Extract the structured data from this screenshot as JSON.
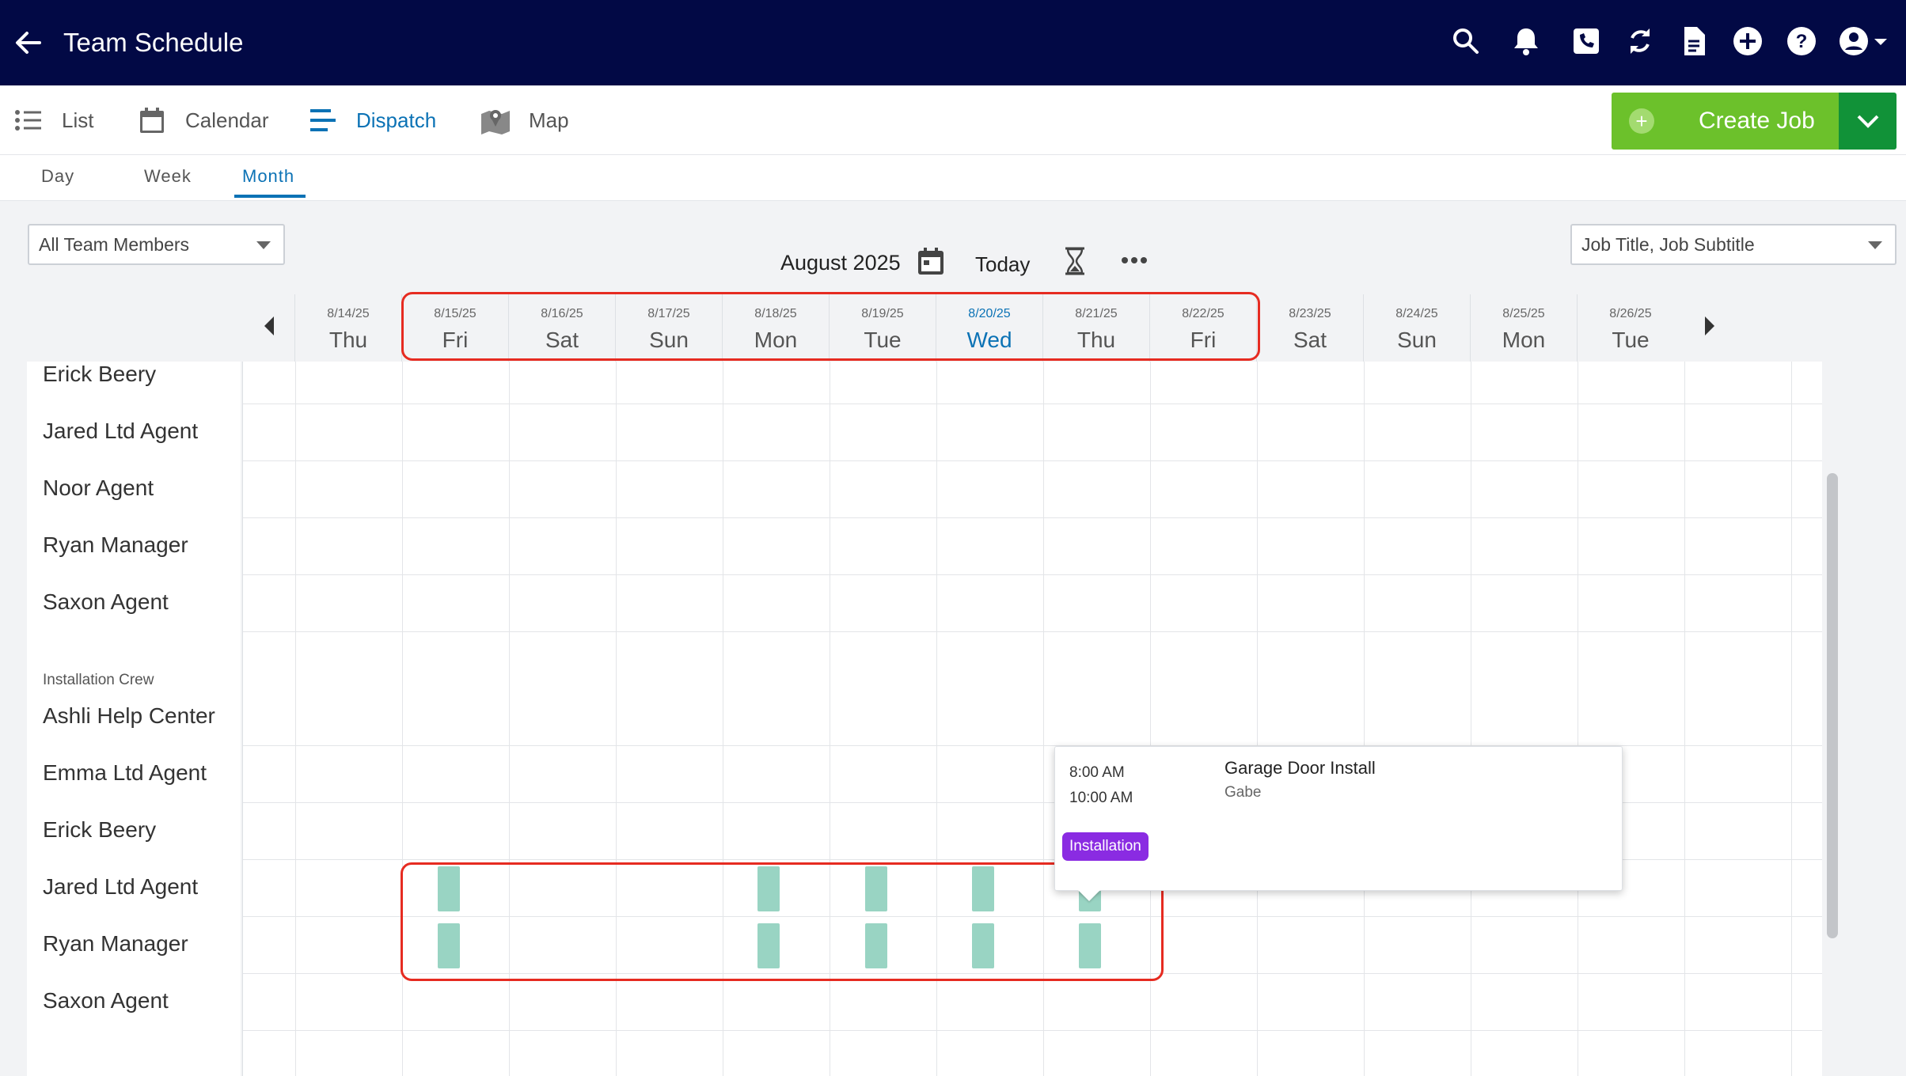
{
  "header": {
    "title": "Team Schedule",
    "icons": [
      "back-arrow-icon",
      "search-icon",
      "bell-icon",
      "phone-icon",
      "sync-icon",
      "document-icon",
      "plus-circle-icon",
      "help-icon",
      "account-icon",
      "caret-down-icon"
    ]
  },
  "views": {
    "list": "List",
    "calendar": "Calendar",
    "dispatch": "Dispatch",
    "map": "Map",
    "active": "Dispatch"
  },
  "create_job": {
    "label": "Create Job"
  },
  "periods": {
    "day": "Day",
    "week": "Week",
    "month": "Month",
    "active": "Month"
  },
  "filters": {
    "members": "All Team Members",
    "display": "Job Title, Job Subtitle"
  },
  "toolbar": {
    "month": "August 2025",
    "today": "Today"
  },
  "dates": [
    {
      "date": "8/14/25",
      "day": "Thu"
    },
    {
      "date": "8/15/25",
      "day": "Fri"
    },
    {
      "date": "8/16/25",
      "day": "Sat"
    },
    {
      "date": "8/17/25",
      "day": "Sun"
    },
    {
      "date": "8/18/25",
      "day": "Mon"
    },
    {
      "date": "8/19/25",
      "day": "Tue"
    },
    {
      "date": "8/20/25",
      "day": "Wed",
      "today": true
    },
    {
      "date": "8/21/25",
      "day": "Thu"
    },
    {
      "date": "8/22/25",
      "day": "Fri"
    },
    {
      "date": "8/23/25",
      "day": "Sat"
    },
    {
      "date": "8/24/25",
      "day": "Sun"
    },
    {
      "date": "8/25/25",
      "day": "Mon"
    },
    {
      "date": "8/26/25",
      "day": "Tue"
    }
  ],
  "members": [
    "Erick Beery",
    "Jared Ltd Agent",
    "Noor Agent",
    "Ryan Manager",
    "Saxon Agent"
  ],
  "group": {
    "label": "Installation Crew",
    "members": [
      "Ashli Help Center",
      "Emma Ltd Agent",
      "Erick Beery",
      "Jared Ltd Agent",
      "Ryan Manager",
      "Saxon Agent"
    ]
  },
  "popup": {
    "start": "8:00 AM",
    "end": "10:00 AM",
    "title": "Garage Door Install",
    "subtitle": "Gabe",
    "tag": "Installation",
    "tag_color": "#8a2be2"
  },
  "colors": {
    "header_bg": "#020945",
    "accent": "#0b72b5",
    "create_green": "#6cc12b",
    "create_dark_green": "#119238",
    "job_block": "#99d4c3",
    "highlight_red": "#e62b21"
  }
}
